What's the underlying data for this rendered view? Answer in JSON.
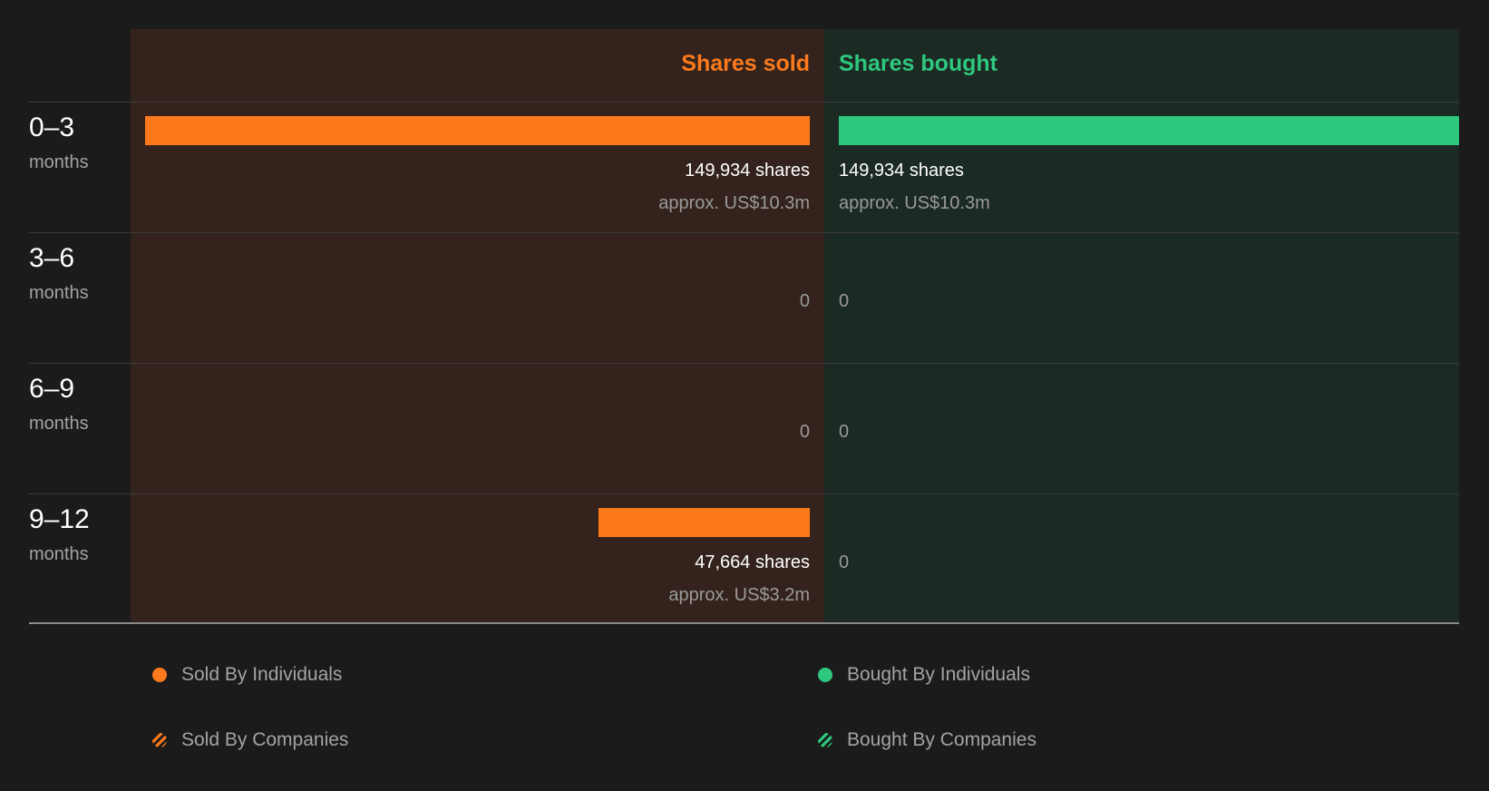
{
  "chart_data": {
    "type": "bar",
    "columns": {
      "sold": "Shares sold",
      "bought": "Shares bought"
    },
    "colors": {
      "sold": "#fd7a1c",
      "bought": "#2ec77e"
    },
    "rows": [
      {
        "range": "0–3",
        "unit": "months",
        "sold_shares": 149934,
        "sold_label": "149,934 shares",
        "sold_approx": "approx. US$10.3m",
        "bought_shares": 149934,
        "bought_label": "149,934 shares",
        "bought_approx": "approx. US$10.3m"
      },
      {
        "range": "3–6",
        "unit": "months",
        "sold_shares": 0,
        "sold_label": "0",
        "sold_approx": "",
        "bought_shares": 0,
        "bought_label": "0",
        "bought_approx": ""
      },
      {
        "range": "6–9",
        "unit": "months",
        "sold_shares": 0,
        "sold_label": "0",
        "sold_approx": "",
        "bought_shares": 0,
        "bought_label": "0",
        "bought_approx": ""
      },
      {
        "range": "9–12",
        "unit": "months",
        "sold_shares": 47664,
        "sold_label": "47,664 shares",
        "sold_approx": "approx. US$3.2m",
        "bought_shares": 0,
        "bought_label": "0",
        "bought_approx": ""
      }
    ],
    "max_shares": 149934,
    "legend": [
      {
        "label": "Sold By Individuals",
        "style": "solid",
        "color": "#fd7a1c"
      },
      {
        "label": "Bought By Individuals",
        "style": "solid",
        "color": "#2ec77e"
      },
      {
        "label": "Sold By Companies",
        "style": "hatched",
        "color": "#fd7a1c"
      },
      {
        "label": "Bought By Companies",
        "style": "hatched",
        "color": "#2ec77e"
      }
    ]
  }
}
